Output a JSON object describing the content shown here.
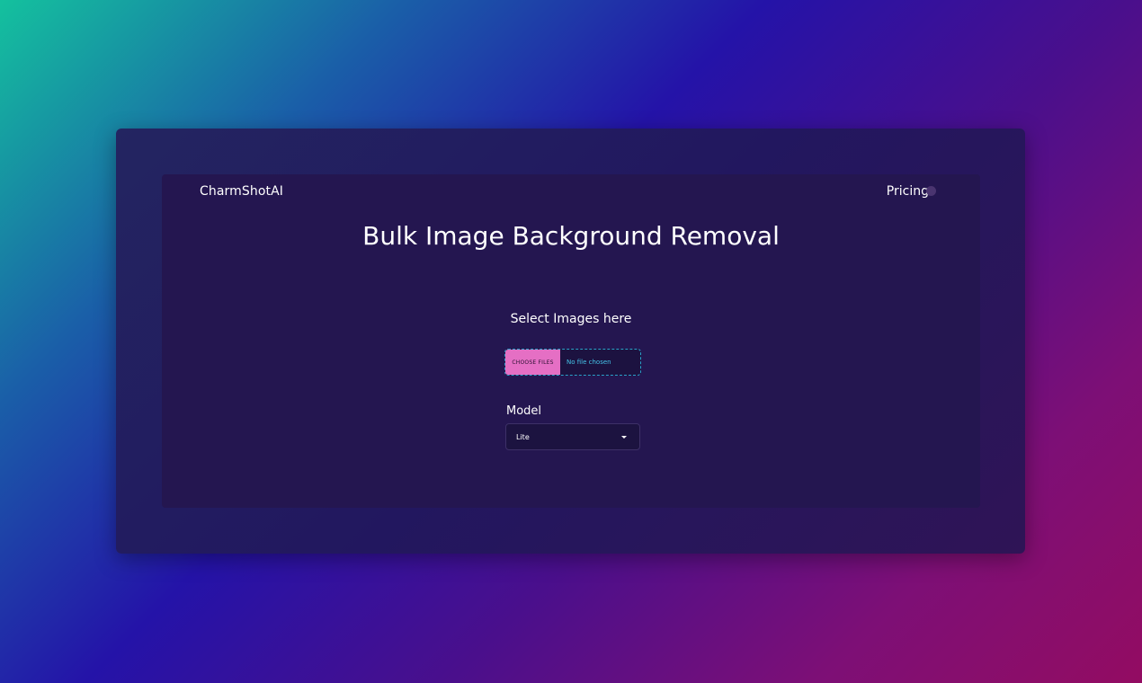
{
  "header": {
    "brand": "CharmShotAI",
    "nav_pricing": "Pricing"
  },
  "main": {
    "title": "Bulk Image Background Removal",
    "upload": {
      "label": "Select Images here",
      "button_label": "CHOOSE FILES",
      "status": "No file chosen"
    },
    "model": {
      "label": "Model",
      "selected": "Lite"
    }
  },
  "colors": {
    "choose_button": "#e56fc4",
    "file_status_text": "#45c3e8",
    "dashed_border": "#2aa0c8",
    "panel": "#241650"
  },
  "icons": {
    "model_dropdown": "caret-down-icon"
  }
}
